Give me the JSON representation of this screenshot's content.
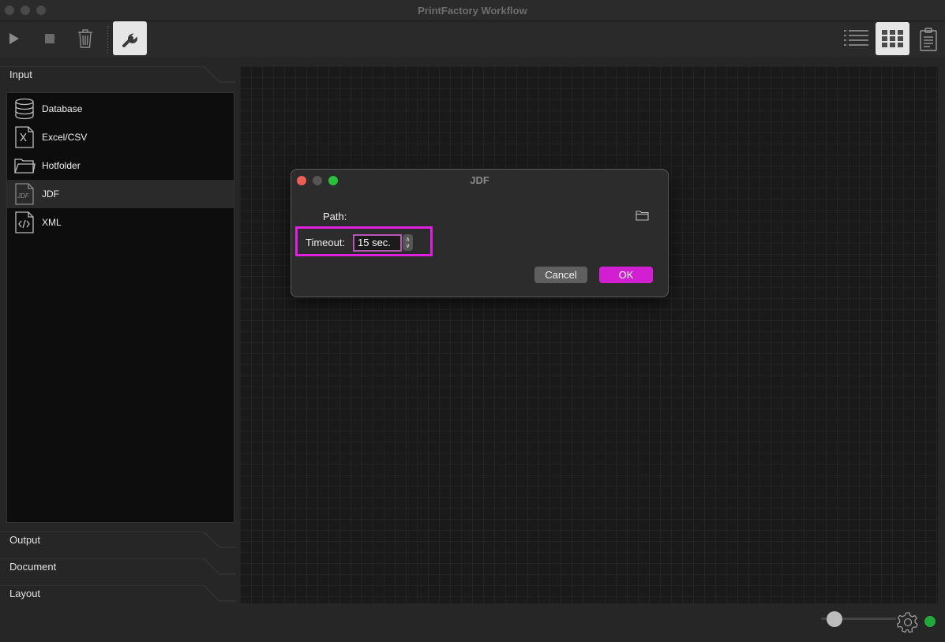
{
  "window": {
    "title": "PrintFactory Workflow"
  },
  "toolbar": {
    "play_icon": "play-icon",
    "stop_icon": "stop-icon",
    "delete_icon": "trash-icon",
    "tool_icon": "wrench-icon",
    "list_view_icon": "list-view-icon",
    "grid_view_icon": "grid-view-icon",
    "clipboard_icon": "clipboard-icon"
  },
  "sidebar": {
    "sections": [
      {
        "label": "Input"
      },
      {
        "label": "Output"
      },
      {
        "label": "Document"
      },
      {
        "label": "Layout"
      }
    ],
    "input_items": [
      {
        "label": "Database",
        "icon": "database-icon"
      },
      {
        "label": "Excel/CSV",
        "icon": "excel-icon"
      },
      {
        "label": "Hotfolder",
        "icon": "folder-icon"
      },
      {
        "label": "JDF",
        "icon": "jdf-file-icon",
        "selected": true
      },
      {
        "label": "XML",
        "icon": "xml-file-icon"
      }
    ]
  },
  "dialog": {
    "title": "JDF",
    "path_label": "Path:",
    "timeout_label": "Timeout:",
    "timeout_value": "15 sec.",
    "cancel_label": "Cancel",
    "ok_label": "OK"
  },
  "colors": {
    "accent": "#d21fd2",
    "highlight": "#e020e0",
    "status": "#22a83a"
  }
}
